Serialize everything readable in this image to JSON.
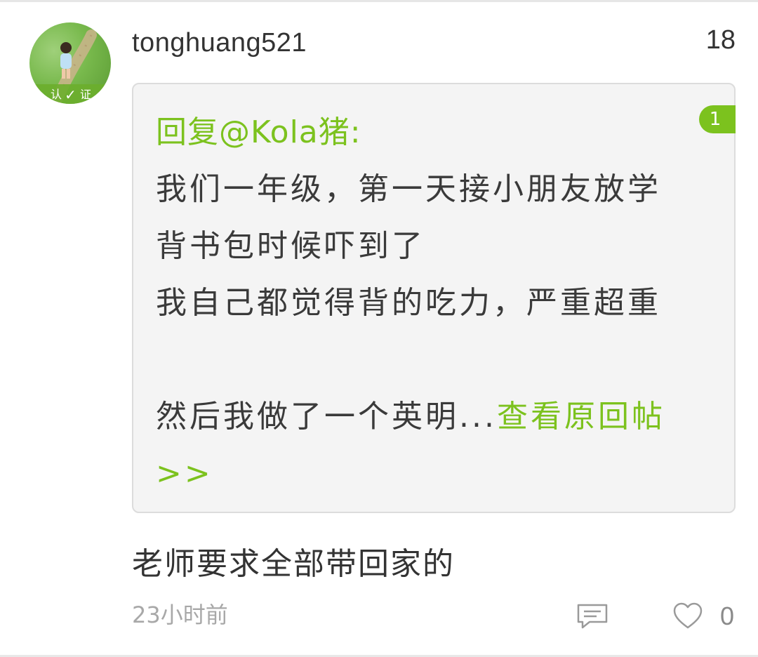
{
  "comment": {
    "username": "tonghuang521",
    "floor": "18",
    "avatar_badge_left": "认",
    "avatar_badge_mark": "✓",
    "avatar_badge_right": "证",
    "quote": {
      "badge_count": "1",
      "reply_prefix": "回复@Kola猪:",
      "lines": [
        "我们一年级，第一天接小朋友放学",
        "背书包时候吓到了",
        "我自己都觉得背的吃力，严重超重",
        "",
        "然后我做了一个英明..."
      ],
      "view_original_link": "查看原回帖",
      "view_original_arrow": ">>"
    },
    "body": "老师要求全部带回家的",
    "timestamp": "23小时前",
    "like_count": "0"
  },
  "colors": {
    "accent": "#7cc21e",
    "text": "#333333",
    "muted": "#a8a8a8",
    "quote_bg": "#f4f4f4"
  },
  "icons": {
    "reply": "comment-bubble-icon",
    "like": "heart-outline-icon"
  }
}
